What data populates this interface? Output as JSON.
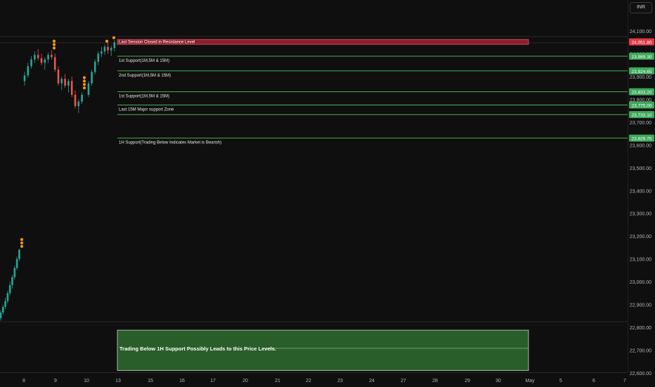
{
  "currency": "INR",
  "chart_data": {
    "type": "candlestick",
    "y_ticks": [
      "24,100.00",
      "24,000.00",
      "23,900.00",
      "23,800.00",
      "23,700.00",
      "23,600.00",
      "23,500.00",
      "23,400.00",
      "23,300.00",
      "23,200.00",
      "23,100.00",
      "23,000.00",
      "22,900.00",
      "22,800.00",
      "22,700.00",
      "22,600.00"
    ],
    "y_tick_values": [
      24100,
      24000,
      23900,
      23800,
      23700,
      23600,
      23500,
      23400,
      23300,
      23200,
      23100,
      23000,
      22900,
      22800,
      22700,
      22600
    ],
    "x_ticks": [
      "8",
      "9",
      "10",
      "13",
      "15",
      "16",
      "17",
      "20",
      "21",
      "22",
      "23",
      "24",
      "27",
      "28",
      "29",
      "30",
      "May",
      "5",
      "6",
      "7"
    ],
    "levels": [
      {
        "label": "Last Session Closed in Resistance Level",
        "value": 24051.8,
        "badge": "24,051.80",
        "kind": "resistance",
        "color": "#c2343f"
      },
      {
        "label": "1st Support(1M,5M & 15M)",
        "value": 23989.3,
        "badge": "23,989.30",
        "kind": "support",
        "color": "#4caf50"
      },
      {
        "label": "2nd Support(1M,5M & 15M)",
        "value": 23924.65,
        "badge": "23,924.65",
        "kind": "support",
        "color": "#4caf50"
      },
      {
        "label": "1st Support(1M,5M & 15M)",
        "value": 23833.2,
        "badge": "23,833.20",
        "kind": "support",
        "color": "#4caf50"
      },
      {
        "label": "Last 15M Major support Zone",
        "value": 23775.0,
        "badge": "23,775.00",
        "kind": "support",
        "color": "#4caf50"
      },
      {
        "label": "",
        "value": 23733.1,
        "badge": "23,733.10",
        "kind": "support",
        "color": "#4caf50"
      },
      {
        "label": "1H Support(Trading Below Indicates Market is Bearish)",
        "value": 23629.75,
        "badge": "23,629.75",
        "kind": "support",
        "color": "#4caf50"
      }
    ],
    "zone": {
      "label": "Trading Below 1H Support Possibly Leads to this Price Levels.",
      "top": 22800,
      "bottom": 22620,
      "mid": 22708,
      "color": "#2e6b2e"
    },
    "ylim": [
      22600,
      24120
    ],
    "series": [
      {
        "session": "8",
        "values": [
          [
            22840,
            22875,
            22830,
            22865
          ],
          [
            22865,
            22900,
            22855,
            22890
          ],
          [
            22890,
            22930,
            22880,
            22915
          ],
          [
            22915,
            22960,
            22905,
            22950
          ],
          [
            22950,
            23000,
            22940,
            22985
          ],
          [
            22985,
            23030,
            22970,
            23020
          ],
          [
            23020,
            23070,
            23010,
            23060
          ],
          [
            23060,
            23110,
            23050,
            23100
          ],
          [
            23100,
            23145,
            23090,
            23140
          ]
        ]
      },
      {
        "session": "9-10",
        "values": [
          [
            23880,
            23920,
            23860,
            23905
          ],
          [
            23905,
            23960,
            23895,
            23945
          ],
          [
            23945,
            23990,
            23935,
            23975
          ],
          [
            23975,
            24010,
            23960,
            23995
          ],
          [
            23995,
            24020,
            23970,
            23980
          ],
          [
            23980,
            24000,
            23950,
            23960
          ],
          [
            23960,
            23985,
            23930,
            23975
          ],
          [
            23975,
            24005,
            23960,
            23995
          ],
          [
            23995,
            24015,
            23975,
            23985
          ],
          [
            23985,
            24000,
            23920,
            23930
          ],
          [
            23930,
            23945,
            23860,
            23870
          ],
          [
            23870,
            23900,
            23840,
            23890
          ],
          [
            23890,
            23910,
            23850,
            23860
          ],
          [
            23860,
            23890,
            23830,
            23880
          ],
          [
            23880,
            23900,
            23810,
            23820
          ],
          [
            23820,
            23840,
            23760,
            23770
          ],
          [
            23770,
            23800,
            23740,
            23790
          ],
          [
            23790,
            23830,
            23780,
            23820
          ]
        ]
      },
      {
        "session": "13",
        "values": [
          [
            23820,
            23880,
            23810,
            23870
          ],
          [
            23870,
            23930,
            23860,
            23920
          ],
          [
            23920,
            23975,
            23910,
            23965
          ],
          [
            23965,
            24010,
            23950,
            24000
          ],
          [
            24000,
            24030,
            23985,
            24010
          ],
          [
            24010,
            24040,
            23995,
            24030
          ],
          [
            24030,
            24050,
            24000,
            24015
          ],
          [
            24015,
            24035,
            23990,
            24025
          ],
          [
            24025,
            24060,
            24010,
            24050
          ]
        ]
      }
    ],
    "markers": [
      {
        "session": "8",
        "value": 23155
      },
      {
        "session": "8",
        "value": 23170
      },
      {
        "session": "8",
        "value": 23185
      },
      {
        "session": "9-10",
        "value": 24025
      },
      {
        "session": "9-10",
        "value": 24040
      },
      {
        "session": "9-10",
        "value": 24055
      },
      {
        "session": "9-10",
        "value": 23850
      },
      {
        "session": "9-10",
        "value": 23865
      },
      {
        "session": "9-10",
        "value": 23880
      },
      {
        "session": "9-10",
        "value": 23895
      },
      {
        "session": "13",
        "value": 24055
      },
      {
        "session": "13",
        "value": 24070
      }
    ]
  }
}
